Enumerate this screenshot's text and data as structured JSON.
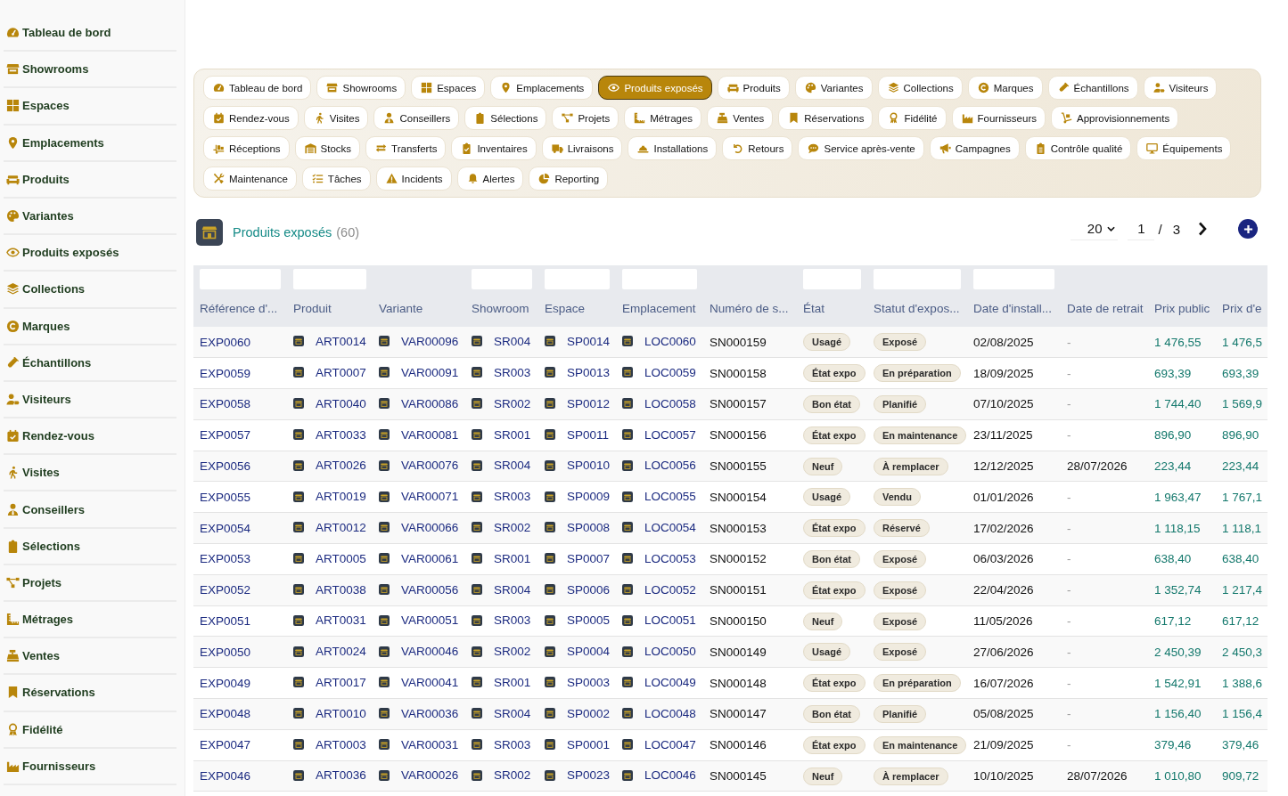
{
  "sidebar": {
    "items": [
      "Tableau de bord",
      "Showrooms",
      "Espaces",
      "Emplacements",
      "Produits",
      "Variantes",
      "Produits exposés",
      "Collections",
      "Marques",
      "Échantillons",
      "Visiteurs",
      "Rendez-vous",
      "Visites",
      "Conseillers",
      "Sélections",
      "Projets",
      "Métrages",
      "Ventes",
      "Réservations",
      "Fidélité",
      "Fournisseurs"
    ]
  },
  "nav_tabs": [
    [
      {
        "label": "Tableau de bord",
        "selected": false
      },
      {
        "label": "Showrooms",
        "selected": false
      },
      {
        "label": "Espaces",
        "selected": false
      },
      {
        "label": "Emplacements",
        "selected": false
      },
      {
        "label": "Produits exposés",
        "selected": true
      },
      {
        "label": "Produits",
        "selected": false
      },
      {
        "label": "Variantes",
        "selected": false
      },
      {
        "label": "Collections",
        "selected": false
      },
      {
        "label": "Marques",
        "selected": false
      },
      {
        "label": "Échantillons",
        "selected": false
      },
      {
        "label": "Visiteurs",
        "selected": false
      }
    ],
    [
      {
        "label": "Rendez-vous",
        "selected": false
      },
      {
        "label": "Visites",
        "selected": false
      },
      {
        "label": "Conseillers",
        "selected": false
      },
      {
        "label": "Sélections",
        "selected": false
      },
      {
        "label": "Projets",
        "selected": false
      },
      {
        "label": "Métrages",
        "selected": false
      },
      {
        "label": "Ventes",
        "selected": false
      },
      {
        "label": "Réservations",
        "selected": false
      },
      {
        "label": "Fidélité",
        "selected": false
      },
      {
        "label": "Fournisseurs",
        "selected": false
      },
      {
        "label": "Approvisionnements",
        "selected": false
      }
    ],
    [
      {
        "label": "Réceptions",
        "selected": false
      },
      {
        "label": "Stocks",
        "selected": false
      },
      {
        "label": "Transferts",
        "selected": false
      },
      {
        "label": "Inventaires",
        "selected": false
      },
      {
        "label": "Livraisons",
        "selected": false
      },
      {
        "label": "Installations",
        "selected": false
      },
      {
        "label": "Retours",
        "selected": false
      },
      {
        "label": "Service après-vente",
        "selected": false
      },
      {
        "label": "Campagnes",
        "selected": false
      },
      {
        "label": "Contrôle qualité",
        "selected": false
      },
      {
        "label": "Équipements",
        "selected": false
      }
    ],
    [
      {
        "label": "Maintenance",
        "selected": false
      },
      {
        "label": "Tâches",
        "selected": false
      },
      {
        "label": "Incidents",
        "selected": false
      },
      {
        "label": "Alertes",
        "selected": false
      },
      {
        "label": "Reporting",
        "selected": false
      }
    ]
  ],
  "header": {
    "title": "Produits exposés",
    "count": "(60)"
  },
  "pagination": {
    "page_size": "20",
    "page": "1",
    "separator": "/",
    "total_pages": "3"
  },
  "table": {
    "columns": [
      {
        "label": "Référence d'...",
        "kind": "link",
        "filter": true
      },
      {
        "label": "Produit",
        "kind": "thumb_link",
        "filter": true
      },
      {
        "label": "Variante",
        "kind": "thumb_link",
        "filter": false
      },
      {
        "label": "Showroom",
        "kind": "thumb_link",
        "filter": true
      },
      {
        "label": "Espace",
        "kind": "thumb_link",
        "filter": true
      },
      {
        "label": "Emplacement",
        "kind": "thumb_link",
        "filter": true
      },
      {
        "label": "Numéro de s...",
        "kind": "text",
        "filter": false
      },
      {
        "label": "État",
        "kind": "badge",
        "filter": true
      },
      {
        "label": "Statut d'expos...",
        "kind": "badge",
        "filter": true
      },
      {
        "label": "Date d'install...",
        "kind": "date",
        "filter": true
      },
      {
        "label": "Date de retrait",
        "kind": "removal_date",
        "filter": false
      },
      {
        "label": "Prix public",
        "kind": "price",
        "filter": false
      },
      {
        "label": "Prix d'e",
        "kind": "price",
        "filter": false
      }
    ],
    "rows": [
      {
        "cells": [
          "EXP0060",
          "ART0014",
          "VAR00096",
          "SR004",
          "SP0014",
          "LOC0060",
          "SN000159",
          "Usagé",
          "Exposé",
          "02/08/2025",
          "-",
          "1 476,55",
          "1 476,5"
        ],
        "removed": false
      },
      {
        "cells": [
          "EXP0059",
          "ART0007",
          "VAR00091",
          "SR003",
          "SP0013",
          "LOC0059",
          "SN000158",
          "État expo",
          "En préparation",
          "18/09/2025",
          "-",
          "693,39",
          "693,39"
        ],
        "removed": false
      },
      {
        "cells": [
          "EXP0058",
          "ART0040",
          "VAR00086",
          "SR002",
          "SP0012",
          "LOC0058",
          "SN000157",
          "Bon état",
          "Planifié",
          "07/10/2025",
          "-",
          "1 744,40",
          "1 569,9"
        ],
        "removed": false
      },
      {
        "cells": [
          "EXP0057",
          "ART0033",
          "VAR00081",
          "SR001",
          "SP0011",
          "LOC0057",
          "SN000156",
          "État expo",
          "En maintenance",
          "23/11/2025",
          "-",
          "896,90",
          "896,90"
        ],
        "removed": false
      },
      {
        "cells": [
          "EXP0056",
          "ART0026",
          "VAR00076",
          "SR004",
          "SP0010",
          "LOC0056",
          "SN000155",
          "Neuf",
          "À remplacer",
          "12/12/2025",
          "28/07/2026",
          "223,44",
          "223,44"
        ],
        "removed": true
      },
      {
        "cells": [
          "EXP0055",
          "ART0019",
          "VAR00071",
          "SR003",
          "SP0009",
          "LOC0055",
          "SN000154",
          "Usagé",
          "Vendu",
          "01/01/2026",
          "-",
          "1 963,47",
          "1 767,1"
        ],
        "removed": false
      },
      {
        "cells": [
          "EXP0054",
          "ART0012",
          "VAR00066",
          "SR002",
          "SP0008",
          "LOC0054",
          "SN000153",
          "État expo",
          "Réservé",
          "17/02/2026",
          "-",
          "1 118,15",
          "1 118,1"
        ],
        "removed": false
      },
      {
        "cells": [
          "EXP0053",
          "ART0005",
          "VAR00061",
          "SR001",
          "SP0007",
          "LOC0053",
          "SN000152",
          "Bon état",
          "Exposé",
          "06/03/2026",
          "-",
          "638,40",
          "638,40"
        ],
        "removed": false
      },
      {
        "cells": [
          "EXP0052",
          "ART0038",
          "VAR00056",
          "SR004",
          "SP0006",
          "LOC0052",
          "SN000151",
          "État expo",
          "Exposé",
          "22/04/2026",
          "-",
          "1 352,74",
          "1 217,4"
        ],
        "removed": false
      },
      {
        "cells": [
          "EXP0051",
          "ART0031",
          "VAR00051",
          "SR003",
          "SP0005",
          "LOC0051",
          "SN000150",
          "Neuf",
          "Exposé",
          "11/05/2026",
          "-",
          "617,12",
          "617,12"
        ],
        "removed": false
      },
      {
        "cells": [
          "EXP0050",
          "ART0024",
          "VAR00046",
          "SR002",
          "SP0004",
          "LOC0050",
          "SN000149",
          "Usagé",
          "Exposé",
          "27/06/2026",
          "-",
          "2 450,39",
          "2 450,3"
        ],
        "removed": false
      },
      {
        "cells": [
          "EXP0049",
          "ART0017",
          "VAR00041",
          "SR001",
          "SP0003",
          "LOC0049",
          "SN000148",
          "État expo",
          "En préparation",
          "16/07/2026",
          "-",
          "1 542,91",
          "1 388,6"
        ],
        "removed": false
      },
      {
        "cells": [
          "EXP0048",
          "ART0010",
          "VAR00036",
          "SR004",
          "SP0002",
          "LOC0048",
          "SN000147",
          "Bon état",
          "Planifié",
          "05/08/2025",
          "-",
          "1 156,40",
          "1 156,4"
        ],
        "removed": false
      },
      {
        "cells": [
          "EXP0047",
          "ART0003",
          "VAR00031",
          "SR003",
          "SP0001",
          "LOC0047",
          "SN000146",
          "État expo",
          "En maintenance",
          "21/09/2025",
          "-",
          "379,46",
          "379,46"
        ],
        "removed": false
      },
      {
        "cells": [
          "EXP0046",
          "ART0036",
          "VAR00026",
          "SR002",
          "SP0023",
          "LOC0046",
          "SN000145",
          "Neuf",
          "À remplacer",
          "10/10/2025",
          "28/07/2026",
          "1 010,80",
          "909,72"
        ],
        "removed": true
      }
    ]
  }
}
